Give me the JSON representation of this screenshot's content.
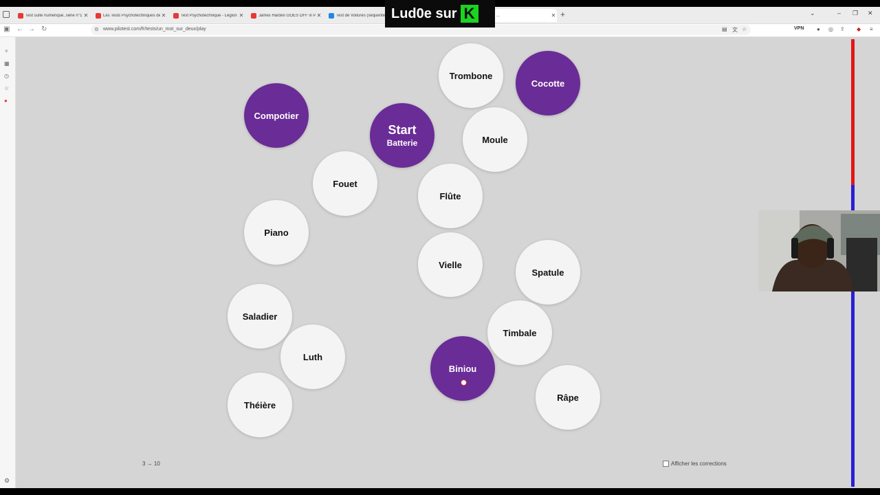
{
  "browser": {
    "tabs": [
      {
        "title": "Test suite numérique, série n°1",
        "fav_color": "#e53935"
      },
      {
        "title": "Les Tests Psychotechniques de",
        "fav_color": "#e53935"
      },
      {
        "title": "Test Psychotechnique - Légion",
        "fav_color": "#e53935"
      },
      {
        "title": "James Harden GOES OFF in Pro",
        "fav_color": "#e53935"
      },
      {
        "title": "Test de Voitures (séquentiel",
        "fav_color": "#1e88e5"
      },
      {
        "title": "...",
        "fav_color": "#6a2c96"
      }
    ],
    "new_tab": "+",
    "window_controls": {
      "minimize": "–",
      "restore": "❐",
      "close": "✕"
    },
    "url": "www.pilotest.com/fr/tests/un_mot_sur_deux/play",
    "vpn_label": "VPN"
  },
  "stream_overlay": {
    "text": "Lud0e sur",
    "logo_letter": "K"
  },
  "game": {
    "bubbles": [
      {
        "label": "Trombone",
        "purple": false
      },
      {
        "label": "Cocotte",
        "purple": true
      },
      {
        "label": "Compotier",
        "purple": true
      },
      {
        "label": "Start",
        "sublabel": "Batterie",
        "purple": true
      },
      {
        "label": "Moule",
        "purple": false
      },
      {
        "label": "Fouet",
        "purple": false
      },
      {
        "label": "Flûte",
        "purple": false
      },
      {
        "label": "Piano",
        "purple": false
      },
      {
        "label": "Vielle",
        "purple": false
      },
      {
        "label": "Spatule",
        "purple": false
      },
      {
        "label": "Saladier",
        "purple": false
      },
      {
        "label": "Timbale",
        "purple": false
      },
      {
        "label": "Luth",
        "purple": false
      },
      {
        "label": "Biniou",
        "purple": true
      },
      {
        "label": "Théière",
        "purple": false
      },
      {
        "label": "Râpe",
        "purple": false
      }
    ],
    "counter": "3 → 10",
    "show_corrections_label": "Afficher les corrections",
    "show_corrections_checked": false,
    "timer_colors": {
      "elapsed": "#e01818",
      "remaining": "#2a1fd6"
    },
    "accent_color": "#6a2c96"
  }
}
